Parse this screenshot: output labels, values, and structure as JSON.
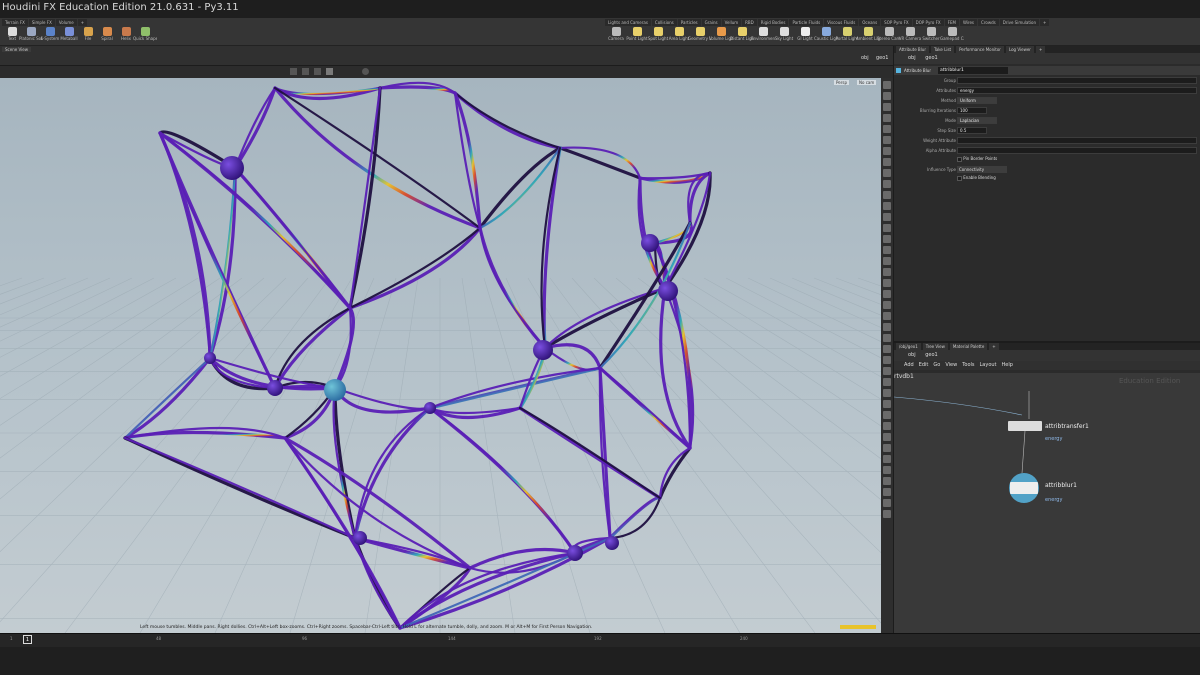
{
  "window": {
    "title": "Houdini FX Education Edition 21.0.631 - Py3.11"
  },
  "shelf": {
    "left_tabs": [
      "Terrain FX",
      "Simple FX",
      "Volume",
      "+"
    ],
    "left_tools": [
      {
        "label": "Text",
        "icon": "text-icon",
        "color": "#dddddd"
      },
      {
        "label": "Platonic Solids",
        "icon": "platonic-icon",
        "color": "#9aa7c2"
      },
      {
        "label": "L-System",
        "icon": "lsystem-icon",
        "color": "#5b83c9"
      },
      {
        "label": "Metaball",
        "icon": "metaball-icon",
        "color": "#7a90d8"
      },
      {
        "label": "File",
        "icon": "file-icon",
        "color": "#d8a34c"
      },
      {
        "label": "Spiral",
        "icon": "spiral-icon",
        "color": "#d88a4c"
      },
      {
        "label": "Helix",
        "icon": "helix-icon",
        "color": "#c97a4c"
      },
      {
        "label": "Quick Shapes",
        "icon": "shapes-icon",
        "color": "#8fbf6a"
      }
    ],
    "right_tabs": [
      "Lights and Cameras",
      "Collisions",
      "Particles",
      "Grains",
      "Vellum",
      "RBD",
      "Rigid Bodies",
      "Particle Fluids",
      "Viscous Fluids",
      "Oceans",
      "SOP Pyro FX",
      "DOP Pyro FX",
      "FEM",
      "Wires",
      "Crowds",
      "Drive Simulation",
      "+"
    ],
    "right_tools": [
      {
        "label": "Camera",
        "icon": "camera-icon",
        "color": "#bbbbbb"
      },
      {
        "label": "Point Light",
        "icon": "point-light-icon",
        "color": "#e8d06a"
      },
      {
        "label": "Spot Light",
        "icon": "spot-light-icon",
        "color": "#e8d06a"
      },
      {
        "label": "Area Light",
        "icon": "area-light-icon",
        "color": "#e8d06a"
      },
      {
        "label": "Geometry Light",
        "icon": "geometry-light-icon",
        "color": "#e8d06a"
      },
      {
        "label": "Volume Light",
        "icon": "volume-light-icon",
        "color": "#e89a4a"
      },
      {
        "label": "Distant Light",
        "icon": "distant-light-icon",
        "color": "#e8d06a"
      },
      {
        "label": "Environment Light",
        "icon": "env-light-icon",
        "color": "#dddddd"
      },
      {
        "label": "Sky Light",
        "icon": "sky-light-icon",
        "color": "#dddddd"
      },
      {
        "label": "GI Light",
        "icon": "gi-light-icon",
        "color": "#eeeeee"
      },
      {
        "label": "Caustic Light",
        "icon": "caustic-light-icon",
        "color": "#88aadd"
      },
      {
        "label": "Portal Light",
        "icon": "portal-light-icon",
        "color": "#d8d070"
      },
      {
        "label": "Ambient Light",
        "icon": "ambient-light-icon",
        "color": "#d8d070"
      },
      {
        "label": "Stereo Camera",
        "icon": "stereo-camera-icon",
        "color": "#bbbbbb"
      },
      {
        "label": "VR Camera",
        "icon": "vr-camera-icon",
        "color": "#bbbbbb"
      },
      {
        "label": "Switcher",
        "icon": "switcher-icon",
        "color": "#bbbbbb"
      },
      {
        "label": "Gamepad Camera",
        "icon": "gamepad-icon",
        "color": "#bbbbbb"
      }
    ]
  },
  "viewport": {
    "pane_label": "Scene View",
    "path_obj": "obj",
    "path_geo": "geo1",
    "persp_label": "Persp",
    "cam_label": "No cam",
    "hint": "Left mouse tumbles. Middle pans. Right dollies. Ctrl+Alt+Left box-zooms. Ctrl+Right zooms. Spacebar-Ctrl-Left tilts. Hold L for alternate tumble, dolly, and zoom.   M or Alt+M for First Person Navigation."
  },
  "parameters": {
    "tabs": [
      "Attribute Blur",
      "Take List",
      "Performance Monitor",
      "Log Viewer",
      "+"
    ],
    "path_obj": "obj",
    "path_geo": "geo1",
    "node_type": "Attribute Blur",
    "node_name": "attribblur1",
    "rows": [
      {
        "label": "Group",
        "value": ""
      },
      {
        "label": "Attributes",
        "value": "energy"
      },
      {
        "label": "Method",
        "value": "Uniform"
      },
      {
        "label": "Blurring Iterations",
        "value": "100"
      },
      {
        "label": "Mode",
        "value": "Laplacian"
      },
      {
        "label": "Step Size",
        "value": "0.5"
      },
      {
        "label": "Weight Attribute",
        "value": ""
      },
      {
        "label": "Alpha Attribute",
        "value": ""
      }
    ],
    "pin_border": "Pin Border Points",
    "influence_label": "Influence Type",
    "influence_value": "Connectivity",
    "enable_blending": "Enable Blending"
  },
  "network": {
    "tabs": [
      "/obj/geo1",
      "Tree View",
      "Material Palette",
      "+"
    ],
    "path_obj": "obj",
    "path_geo": "geo1",
    "menu": [
      "Add",
      "Edit",
      "Go",
      "View",
      "Tools",
      "Layout",
      "Help"
    ],
    "watermark": "Education Edition",
    "node_left": "rtvdb1",
    "nodes": [
      {
        "name": "attribtransfer1",
        "sub": "energy"
      },
      {
        "name": "attribblur1",
        "sub": "energy"
      }
    ]
  },
  "timeline": {
    "frame": "1",
    "ticks": [
      "1",
      "48",
      "96",
      "144",
      "192",
      "240"
    ]
  },
  "colors": {
    "accent": "#e8c32b",
    "curve": "#5a1fb5",
    "node_sphere": "#4a22a8",
    "selected_node": "#57b5e0"
  }
}
